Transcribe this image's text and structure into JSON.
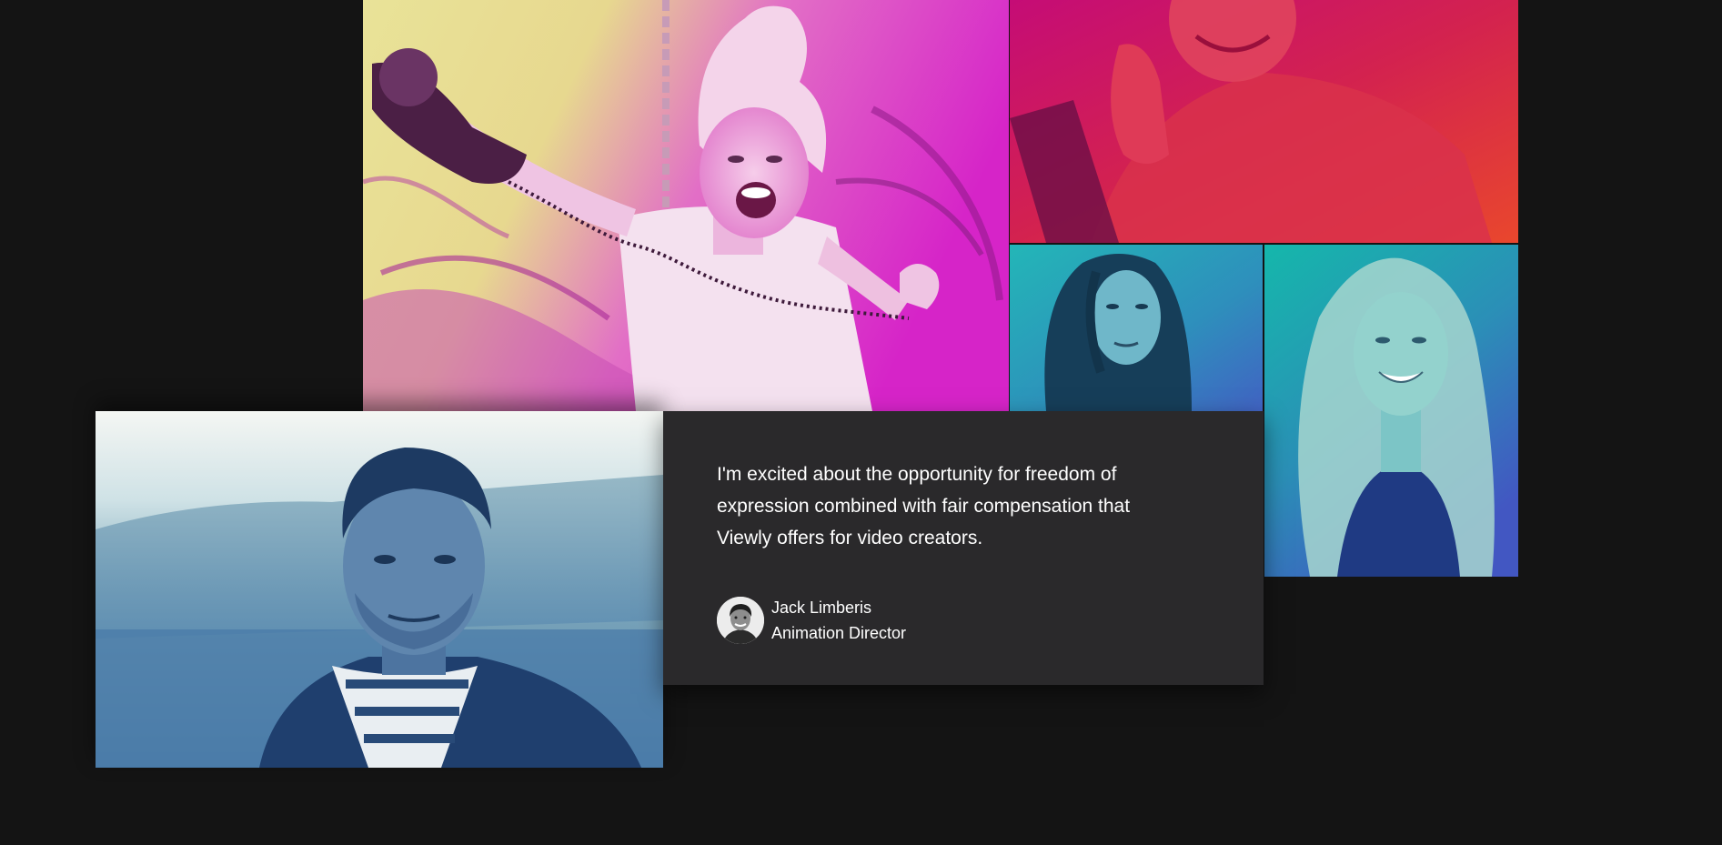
{
  "testimonial": {
    "quote": "I'm excited about the opportunity for freedom of expression combined with fair compensation that Viewly offers for video creators.",
    "author_name": "Jack Limberis",
    "author_role": "Animation Director"
  },
  "photos": {
    "pink": {
      "tint_start": "#e7e28f",
      "tint_end": "#d41cc4"
    },
    "red": {
      "tint_start": "#c80e6e",
      "tint_end": "#e8452f"
    },
    "teal_left": {
      "tint_start": "#22b3b8",
      "tint_end": "#3d64c0"
    },
    "teal_right": {
      "tint_start": "#19b5ad",
      "tint_end": "#4157c1"
    },
    "blue": {
      "tint_start": "#eef3f3",
      "tint_end": "#2d5aa8"
    }
  },
  "colors": {
    "page_background": "#141414",
    "card_background": "#2a292b",
    "text": "#ffffff"
  }
}
